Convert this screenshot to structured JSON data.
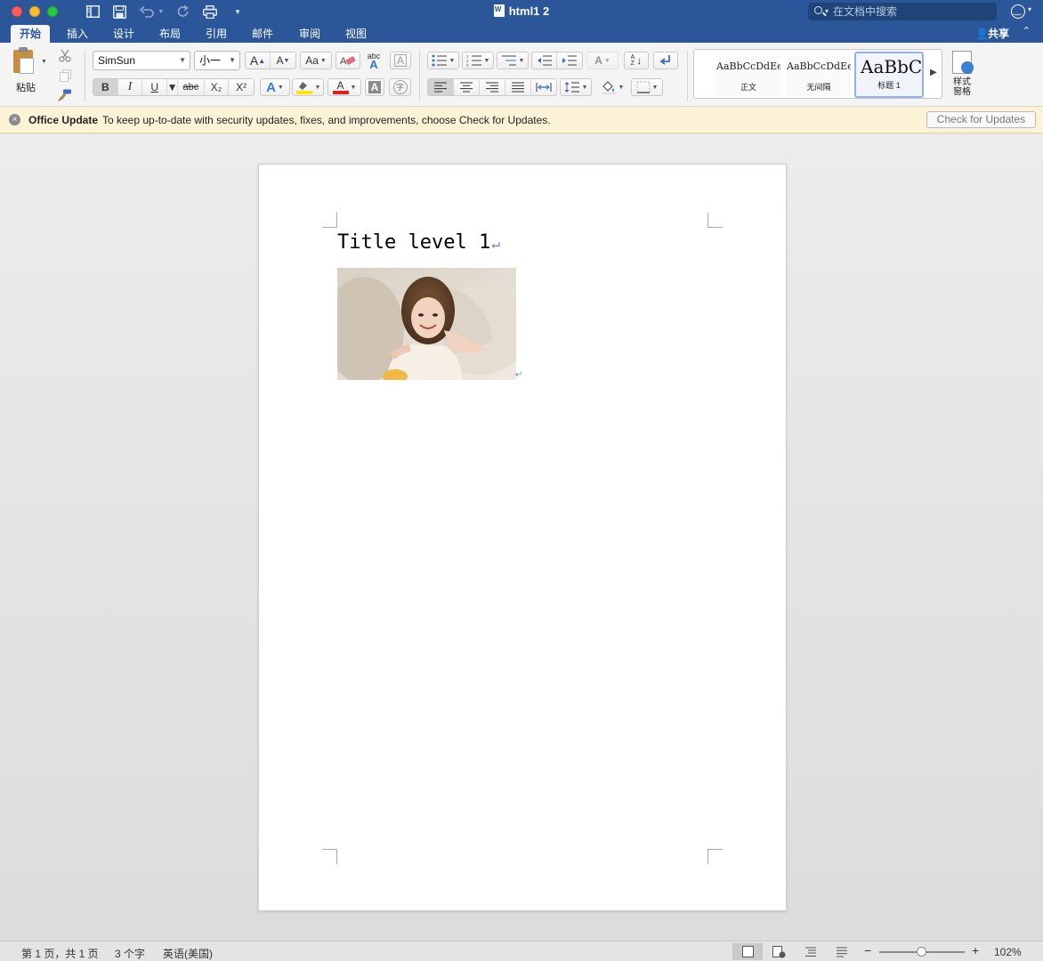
{
  "window": {
    "title": "html1 2",
    "search_placeholder": "在文档中搜索"
  },
  "tabs": [
    {
      "label": "开始",
      "active": true
    },
    {
      "label": "插入"
    },
    {
      "label": "设计"
    },
    {
      "label": "布局"
    },
    {
      "label": "引用"
    },
    {
      "label": "邮件"
    },
    {
      "label": "审阅"
    },
    {
      "label": "视图"
    }
  ],
  "share_label": "共享",
  "ribbon": {
    "paste_label": "粘贴",
    "font_name": "SimSun",
    "font_size": "小一",
    "styles": [
      {
        "sample": "AaBbCcDdEe",
        "name": "正文"
      },
      {
        "sample": "AaBbCcDdEe",
        "name": "无间隔"
      },
      {
        "sample": "AaBbCc",
        "name": "标题 1",
        "selected": true
      }
    ],
    "styles_pane_label_1": "样式",
    "styles_pane_label_2": "窗格",
    "glyphs": {
      "bold": "B",
      "italic": "I",
      "underline": "U",
      "strike": "abc",
      "subscript": "X₂",
      "superscript": "X²",
      "abc_small": "abc",
      "font_color": "A",
      "char_shade": "A",
      "enclose": "字",
      "grow": "A",
      "shrink": "A",
      "case": "Aa",
      "sort_a": "A",
      "sort_z": "Z"
    }
  },
  "update_bar": {
    "title": "Office Update",
    "message": "To keep up-to-date with security updates, fixes, and improvements, choose Check for Updates.",
    "button": "Check for Updates"
  },
  "document": {
    "heading": "Title level 1",
    "paragraph_mark": "↵"
  },
  "status": {
    "page": "第 1 页，共 1 页",
    "words": "3 个字",
    "language": "英语(美国)",
    "zoom": "102%",
    "zoom_minus": "−",
    "zoom_plus": "+"
  },
  "colors": {
    "accent": "#2b579a",
    "update_bar_bg": "#fcf3d7",
    "highlight": "#ffe600",
    "font_color_bar": "#e02020"
  }
}
